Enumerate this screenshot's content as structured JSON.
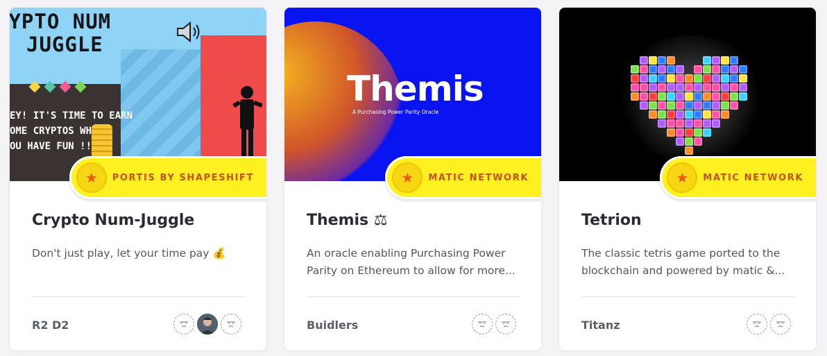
{
  "cards": [
    {
      "sponsor": "PORTIS BY SHAPESHIFT",
      "sponsor_icon": "star-badge-icon",
      "title": "Crypto Num-Juggle",
      "description": "Don't just play, let your time pay 💰",
      "team": "R2 D2",
      "thumbnail": {
        "title_lines": [
          "RYPTO NUM",
          "JUGGLE"
        ],
        "panel_lines": [
          "EY! IT'S TIME TO EARN",
          "OME CRYPTOS WHILE",
          "OU HAVE FUN !!"
        ]
      }
    },
    {
      "sponsor": "MATIC NETWORK",
      "sponsor_icon": "star-badge-icon",
      "title": "Themis ⚖",
      "description": "An oracle enabling Purchasing Power Parity on Ethereum to allow for more...",
      "team": "Buidlers",
      "thumbnail": {
        "brand": "Themis",
        "tagline": "A Purchasing Power Parity Oracle"
      }
    },
    {
      "sponsor": "MATIC NETWORK",
      "sponsor_icon": "star-badge-icon",
      "title": "Tetrion",
      "description": "The classic tetris game ported to the blockchain and powered by matic &...",
      "team": "Titanz"
    }
  ],
  "colors": {
    "badge_bg": "#fff021",
    "badge_text": "#c3521b",
    "themis_bg": "#0a14f0",
    "juggle_bg": "#8fd3f6"
  }
}
